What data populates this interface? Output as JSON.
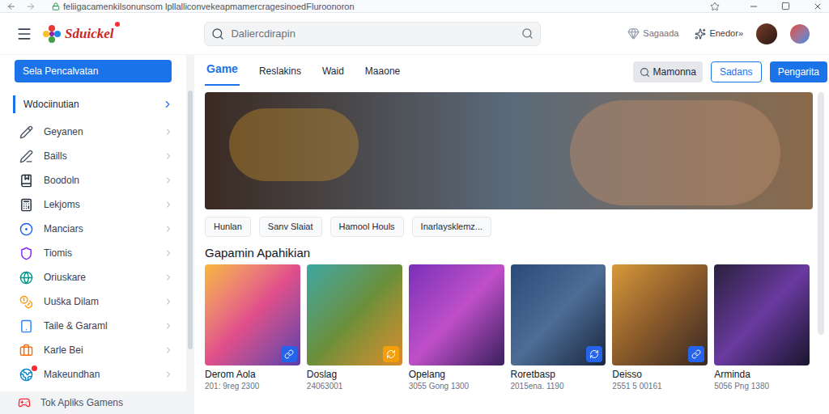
{
  "browser": {
    "address": "feliigacamenkilsonunsom lpllalliconvekeapmamercragesinoedFluroonoron"
  },
  "logo": {
    "text": "Sduickel"
  },
  "search": {
    "placeholder": "Daliercdirapin"
  },
  "header_actions": [
    {
      "label": "Sagaada"
    },
    {
      "label": "Enedor»"
    }
  ],
  "sidebar": {
    "primary_button": "Sela Pencalvatan",
    "section": {
      "label": "Wdociinutian",
      "selected": true
    },
    "items": [
      {
        "label": "Geyanen",
        "badge": false
      },
      {
        "label": "Baills",
        "badge": false
      },
      {
        "label": "Boodoln",
        "badge": false
      },
      {
        "label": "Lekjoms",
        "badge": false
      },
      {
        "label": "Manciars",
        "badge": false
      },
      {
        "label": "Tiomis",
        "badge": false
      },
      {
        "label": "Oriuskare",
        "badge": false
      },
      {
        "label": "Uuška Dilam",
        "badge": false
      },
      {
        "label": "Taile & Garaml",
        "badge": false
      },
      {
        "label": "Karle Bei",
        "badge": false
      },
      {
        "label": "Makeundhan",
        "badge": true
      }
    ],
    "footer": "Tok Apliks Gamens"
  },
  "tabs": [
    {
      "label": "Game",
      "selected": true
    },
    {
      "label": "Reslakins",
      "selected": false
    },
    {
      "label": "Waid",
      "selected": false
    },
    {
      "label": "Maaone",
      "selected": false
    }
  ],
  "toolbar_buttons": [
    {
      "label": "Mamonna",
      "kind": "search"
    },
    {
      "label": "Sadans",
      "kind": "outline"
    },
    {
      "label": "Pengarita",
      "kind": "primary"
    }
  ],
  "chips": [
    "Hunlan",
    "Sanv Slaiat",
    "Hamool Houls",
    "Inarlaysklemz..."
  ],
  "section_title": "Gapamin Apahikian",
  "games": [
    {
      "title": "Derom Aola",
      "meta": "201: 9reg 2300",
      "badge": true,
      "color": "#2563eb"
    },
    {
      "title": "Doslag",
      "meta": "24063001",
      "badge": true,
      "color": "#f59e0b"
    },
    {
      "title": "Opelang",
      "meta": "3055 Gong 1300",
      "badge": false,
      "color": "#2563eb"
    },
    {
      "title": "Roretbasp",
      "meta": "2015ena. 1190",
      "badge": true,
      "color": "#2563eb"
    },
    {
      "title": "Deisso",
      "meta": "2551 5 00161",
      "badge": true,
      "color": "#2563eb"
    },
    {
      "title": "Arminda",
      "meta": "5056 Png 1380",
      "badge": false,
      "color": "#2563eb"
    }
  ]
}
